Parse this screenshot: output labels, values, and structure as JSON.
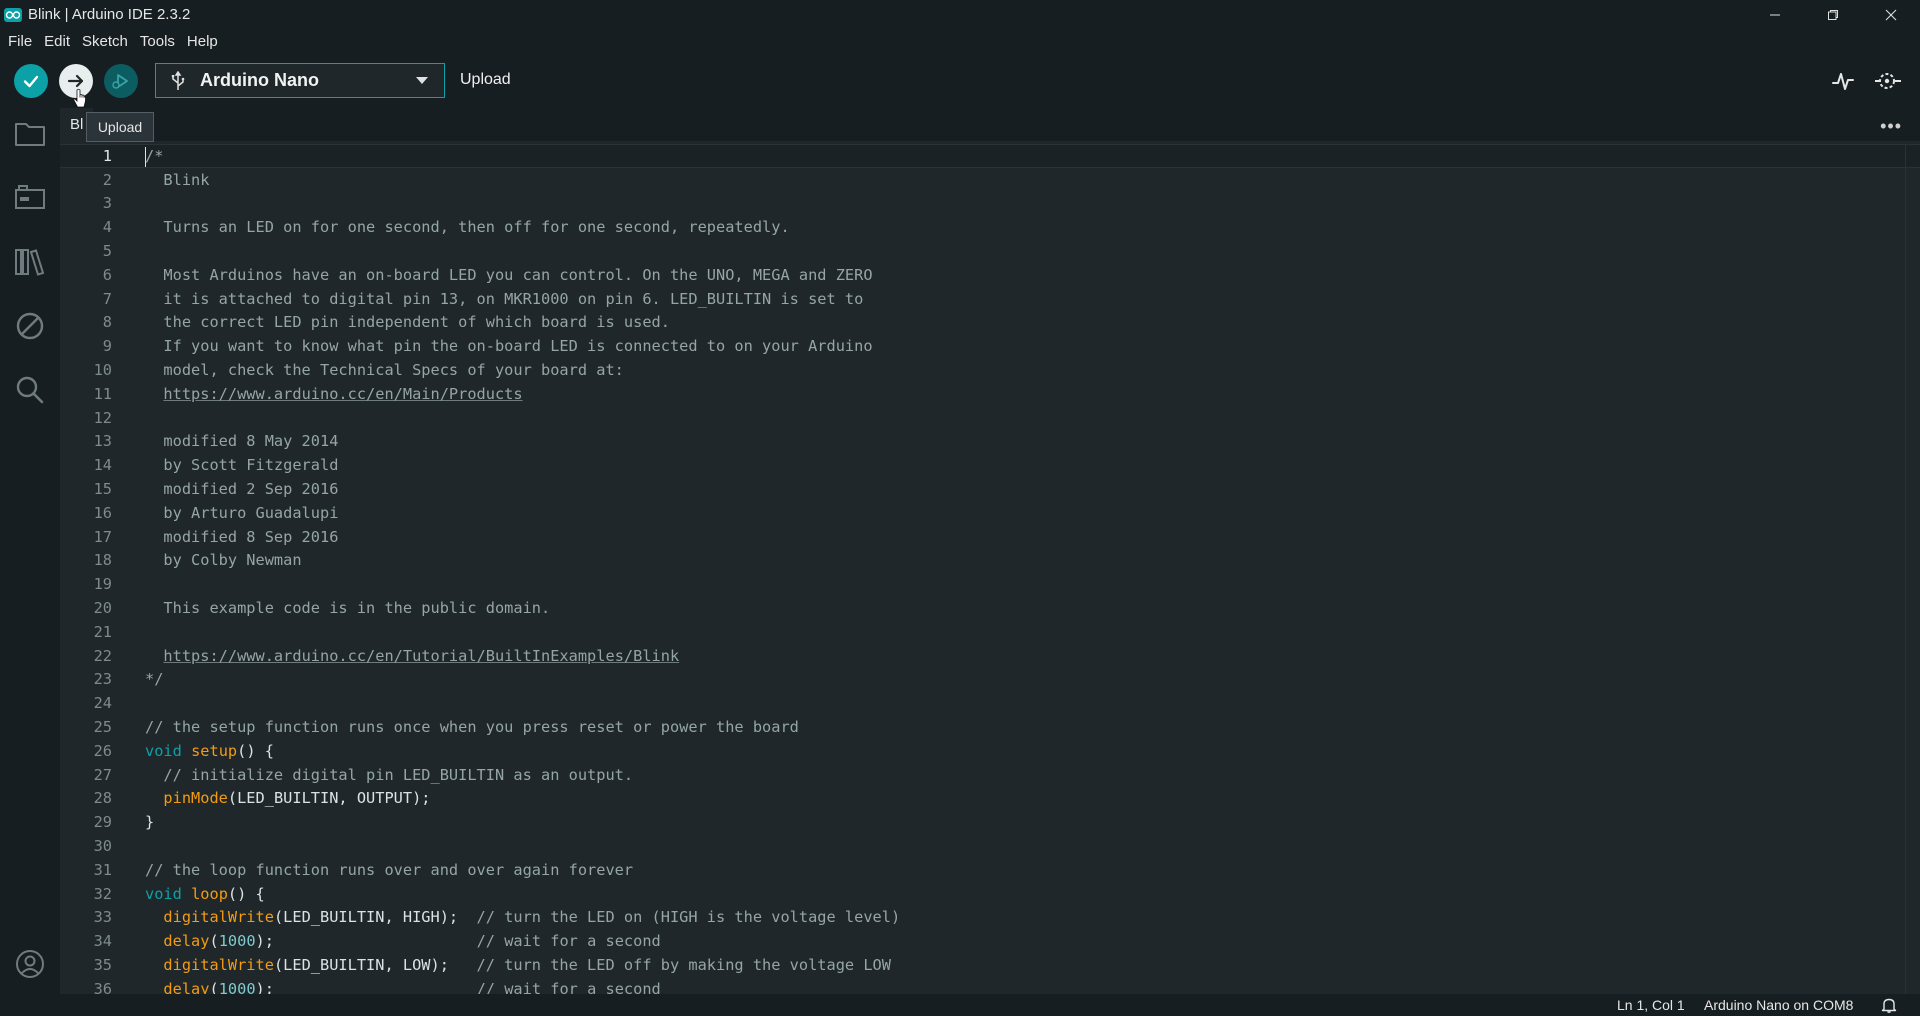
{
  "window": {
    "title": "Blink | Arduino IDE 2.3.2"
  },
  "menu": [
    "File",
    "Edit",
    "Sketch",
    "Tools",
    "Help"
  ],
  "toolbar": {
    "board": "Arduino Nano",
    "action_label": "Upload",
    "tooltip": "Upload"
  },
  "tabs": [
    {
      "label": "Bl"
    }
  ],
  "editor": {
    "current_line": 1,
    "lines": [
      [
        {
          "t": "/*",
          "c": "c-comment"
        }
      ],
      [
        {
          "t": "  Blink",
          "c": "c-comment"
        }
      ],
      [],
      [
        {
          "t": "  Turns an LED on for one second, then off for one second, repeatedly.",
          "c": "c-comment"
        }
      ],
      [],
      [
        {
          "t": "  Most Arduinos have an on-board LED you can control. On the UNO, MEGA and ZERO",
          "c": "c-comment"
        }
      ],
      [
        {
          "t": "  it is attached to digital pin 13, on MKR1000 on pin 6. LED_BUILTIN is set to",
          "c": "c-comment"
        }
      ],
      [
        {
          "t": "  the correct LED pin independent of which board is used.",
          "c": "c-comment"
        }
      ],
      [
        {
          "t": "  If you want to know what pin the on-board LED is connected to on your Arduino",
          "c": "c-comment"
        }
      ],
      [
        {
          "t": "  model, check the Technical Specs of your board at:",
          "c": "c-comment"
        }
      ],
      [
        {
          "t": "  ",
          "c": "c-comment"
        },
        {
          "t": "https://www.arduino.cc/en/Main/Products",
          "c": "c-link"
        }
      ],
      [],
      [
        {
          "t": "  modified 8 May 2014",
          "c": "c-comment"
        }
      ],
      [
        {
          "t": "  by Scott Fitzgerald",
          "c": "c-comment"
        }
      ],
      [
        {
          "t": "  modified 2 Sep 2016",
          "c": "c-comment"
        }
      ],
      [
        {
          "t": "  by Arturo Guadalupi",
          "c": "c-comment"
        }
      ],
      [
        {
          "t": "  modified 8 Sep 2016",
          "c": "c-comment"
        }
      ],
      [
        {
          "t": "  by Colby Newman",
          "c": "c-comment"
        }
      ],
      [],
      [
        {
          "t": "  This example code is in the public domain.",
          "c": "c-comment"
        }
      ],
      [],
      [
        {
          "t": "  ",
          "c": "c-comment"
        },
        {
          "t": "https://www.arduino.cc/en/Tutorial/BuiltInExamples/Blink",
          "c": "c-link"
        }
      ],
      [
        {
          "t": "*/",
          "c": "c-comment"
        }
      ],
      [],
      [
        {
          "t": "// the setup function runs once when you press reset or power the board",
          "c": "c-comment"
        }
      ],
      [
        {
          "t": "void",
          "c": "c-kw"
        },
        {
          "t": " "
        },
        {
          "t": "setup",
          "c": "c-fn"
        },
        {
          "t": "() {"
        }
      ],
      [
        {
          "t": "  // initialize digital pin LED_BUILTIN as an output.",
          "c": "c-comment"
        }
      ],
      [
        {
          "t": "  "
        },
        {
          "t": "pinMode",
          "c": "c-fn"
        },
        {
          "t": "(LED_BUILTIN, OUTPUT);"
        }
      ],
      [
        {
          "t": "}"
        }
      ],
      [],
      [
        {
          "t": "// the loop function runs over and over again forever",
          "c": "c-comment"
        }
      ],
      [
        {
          "t": "void",
          "c": "c-kw"
        },
        {
          "t": " "
        },
        {
          "t": "loop",
          "c": "c-fn"
        },
        {
          "t": "() {"
        }
      ],
      [
        {
          "t": "  "
        },
        {
          "t": "digitalWrite",
          "c": "c-fn"
        },
        {
          "t": "(LED_BUILTIN, HIGH);  "
        },
        {
          "t": "// turn the LED on (HIGH is the voltage level)",
          "c": "c-comment"
        }
      ],
      [
        {
          "t": "  "
        },
        {
          "t": "delay",
          "c": "c-fn"
        },
        {
          "t": "("
        },
        {
          "t": "1000",
          "c": "c-num"
        },
        {
          "t": ");                      "
        },
        {
          "t": "// wait for a second",
          "c": "c-comment"
        }
      ],
      [
        {
          "t": "  "
        },
        {
          "t": "digitalWrite",
          "c": "c-fn"
        },
        {
          "t": "(LED_BUILTIN, LOW);   "
        },
        {
          "t": "// turn the LED off by making the voltage LOW",
          "c": "c-comment"
        }
      ],
      [
        {
          "t": "  "
        },
        {
          "t": "delay",
          "c": "c-fn"
        },
        {
          "t": "("
        },
        {
          "t": "1000",
          "c": "c-num"
        },
        {
          "t": ");                      "
        },
        {
          "t": "// wait for a second",
          "c": "c-comment"
        }
      ]
    ]
  },
  "status": {
    "position": "Ln 1, Col 1",
    "board_port": "Arduino Nano on COM8"
  },
  "colors": {
    "accent": "#0ca1a6",
    "background": "#1f272a",
    "chrome": "#171e21",
    "function": "#f39c12"
  },
  "icons": {
    "sidebar": [
      "folder-icon",
      "board-manager-icon",
      "library-icon",
      "debug-icon",
      "search-icon",
      "account-icon"
    ]
  }
}
